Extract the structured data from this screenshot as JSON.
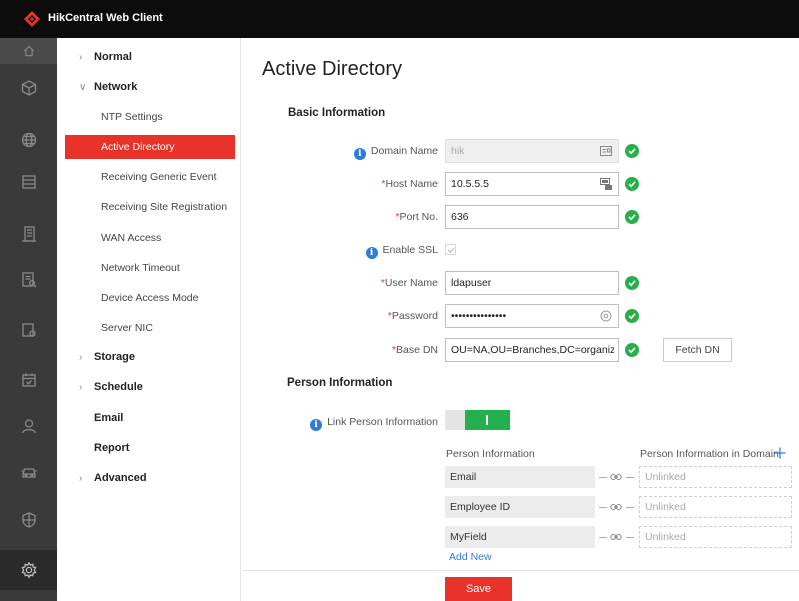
{
  "app": {
    "title": "HikCentral Web Client",
    "brand_color": "#e8322a"
  },
  "icon_rail": [
    {
      "name": "home-icon",
      "active": false
    },
    {
      "name": "cube-icon",
      "active": false
    },
    {
      "name": "globe-icon",
      "active": false
    },
    {
      "name": "storage-icon",
      "active": false
    },
    {
      "name": "building-icon",
      "active": false
    },
    {
      "name": "document-search-icon",
      "active": false
    },
    {
      "name": "device-file-icon",
      "active": false
    },
    {
      "name": "calendar-icon",
      "active": false
    },
    {
      "name": "person-icon",
      "active": false
    },
    {
      "name": "vehicle-icon",
      "active": false
    },
    {
      "name": "shield-icon",
      "active": false
    },
    {
      "name": "gear-icon",
      "active": true
    }
  ],
  "nav": {
    "groups": {
      "normal": "Normal",
      "network": "Network",
      "storage": "Storage",
      "schedule": "Schedule",
      "email": "Email",
      "report": "Report",
      "advanced": "Advanced"
    },
    "network_items": [
      "NTP Settings",
      "Active Directory",
      "Receiving Generic Event",
      "Receiving Site Registration",
      "WAN Access",
      "Network Timeout",
      "Device Access Mode",
      "Server NIC"
    ],
    "active_item": "Active Directory"
  },
  "page": {
    "title": "Active Directory",
    "basic_section": "Basic Information",
    "person_section": "Person Information"
  },
  "form": {
    "domain_name": {
      "label": "Domain Name",
      "value": "hik"
    },
    "host_name": {
      "required_mark": "*",
      "label": "Host Name",
      "value": "10.5.5.5"
    },
    "port_no": {
      "required_mark": "*",
      "label": "Port No.",
      "value": "636"
    },
    "enable_ssl": {
      "label": "Enable SSL",
      "checked": true
    },
    "user_name": {
      "required_mark": "*",
      "label": "User Name",
      "value": "ldapuser"
    },
    "password": {
      "required_mark": "*",
      "label": "Password",
      "value": "•••••••••••••••"
    },
    "base_dn": {
      "required_mark": "*",
      "label": "Base DN",
      "value": "OU=NA,OU=Branches,DC=organizatio"
    },
    "fetch_dn": "Fetch DN"
  },
  "person": {
    "link_label": "Link Person Information",
    "link_enabled": true,
    "col_person": "Person Information",
    "col_domain": "Person Information in Domain",
    "rows": [
      {
        "field": "Email",
        "domain": "Unlinked"
      },
      {
        "field": "Employee ID",
        "domain": "Unlinked"
      },
      {
        "field": "MyField",
        "domain": "Unlinked"
      }
    ],
    "add_new": "Add New"
  },
  "save_label": "Save"
}
